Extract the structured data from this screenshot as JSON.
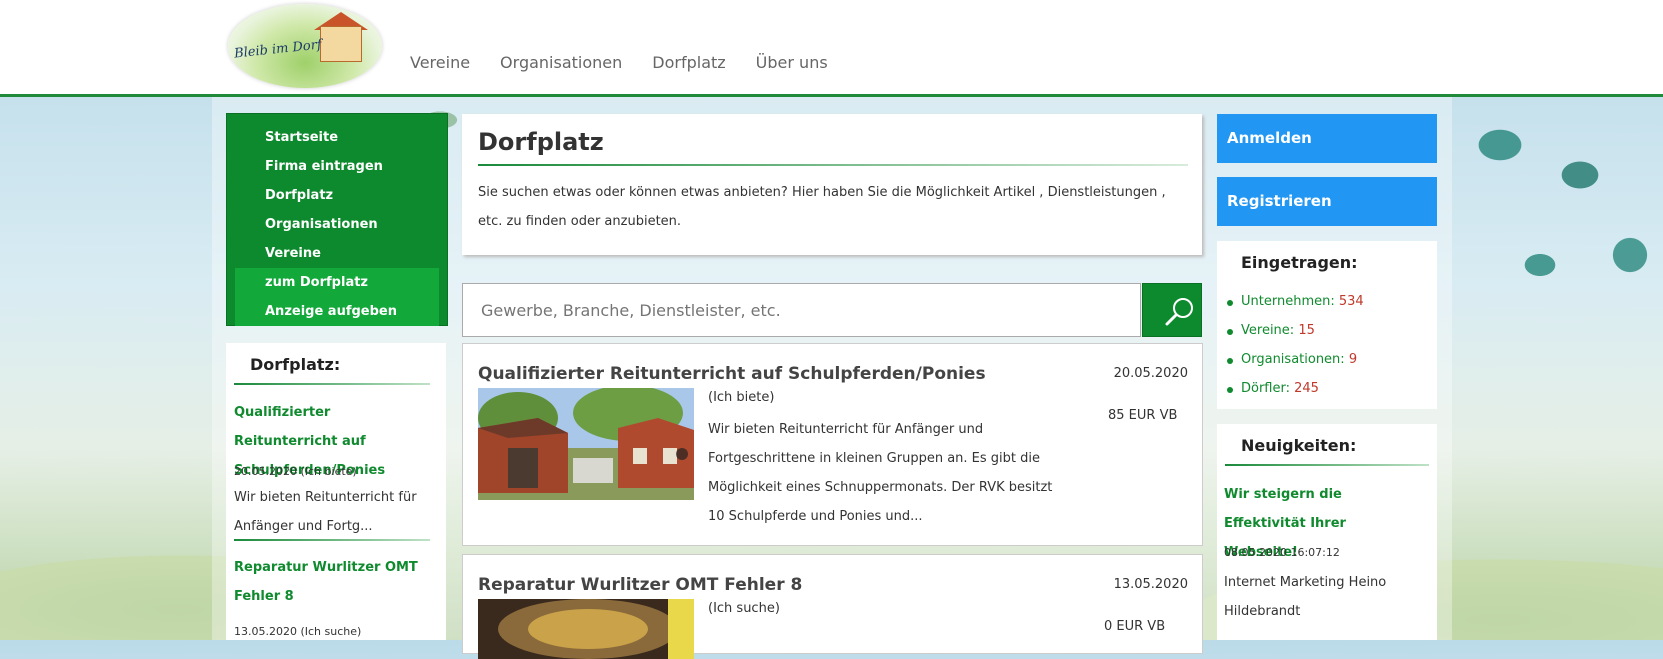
{
  "logo": {
    "text": "Bleib im Dorf"
  },
  "topnav": [
    "Vereine",
    "Organisationen",
    "Dorfplatz",
    "Über uns"
  ],
  "leftnav": [
    "Startseite",
    "Firma eintragen",
    "Dorfplatz",
    "Organisationen",
    "Vereine"
  ],
  "leftnav_sub": [
    "zum Dorfplatz",
    "Anzeige aufgeben"
  ],
  "left_box": {
    "title": "Dorfplatz:",
    "items": [
      {
        "title": "Qualifizierter Reitunterricht auf Schulpferden/Ponies",
        "meta": "20.05.2020 (Ich biete)",
        "text": "Wir bieten Reitunterricht für Anfänger und Fortg..."
      },
      {
        "title": "Reparatur Wurlitzer OMT Fehler 8",
        "meta": "13.05.2020 (Ich suche)"
      }
    ]
  },
  "intro": {
    "title": "Dorfplatz",
    "text": "Sie suchen etwas oder können etwas anbieten? Hier haben Sie die Möglichkeit Artikel , Dienstleistungen , etc. zu finden oder anzubieten."
  },
  "search": {
    "placeholder": "Gewerbe, Branche, Dienstleister, etc."
  },
  "listings": [
    {
      "title": "Qualifizierter Reitunterricht auf Schulpferden/Ponies",
      "date": "20.05.2020",
      "type": "(Ich biete)",
      "desc": "Wir bieten Reitunterricht für Anfänger und Fortgeschrittene in kleinen Gruppen an. Es gibt die Möglichkeit eines Schnuppermonats. Der RVK besitzt 10 Schulpferde und Ponies und...",
      "price": "85 EUR VB"
    },
    {
      "title": "Reparatur Wurlitzer OMT Fehler 8",
      "date": "13.05.2020",
      "type": "(Ich suche)",
      "price": "0 EUR VB"
    }
  ],
  "right": {
    "login": "Anmelden",
    "register": "Registrieren",
    "stats_title": "Eingetragen:",
    "stats": [
      {
        "label": "Unternehmen:",
        "value": "534"
      },
      {
        "label": "Vereine:",
        "value": "15"
      },
      {
        "label": "Organisationen:",
        "value": "9"
      },
      {
        "label": "Dörfler:",
        "value": "245"
      }
    ],
    "news_title": "Neuigkeiten:",
    "news": [
      {
        "title": "Wir steigern die Effektivität Ihrer Webseite!",
        "meta": "08.05.2020 16:07:12",
        "text": "Internet Marketing Heino Hildebrandt"
      }
    ]
  },
  "colors": {
    "green": "#0e8a2e",
    "blue": "#2196f3",
    "number_red": "#c0392b"
  }
}
